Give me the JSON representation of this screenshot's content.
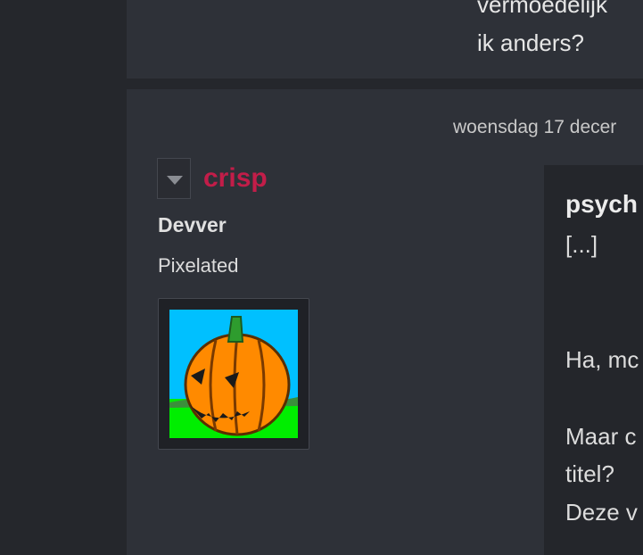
{
  "previous_post": {
    "lines": [
      "vermoedelijk",
      "ik anders?"
    ]
  },
  "post": {
    "date": "woensdag 17 decer",
    "author": {
      "name": "crisp",
      "role": "Devver",
      "title": "Pixelated",
      "avatar": "pumpkin-avatar-icon"
    },
    "quote_author": "psych",
    "quote_snippet": "[...]",
    "lines": [
      "Ha, mc",
      "Maar c",
      "titel?",
      "Deze v"
    ]
  },
  "colors": {
    "background": "#25272c",
    "post_bg": "#2e3138",
    "content_bg": "#24262b",
    "username": "#c21d49"
  }
}
